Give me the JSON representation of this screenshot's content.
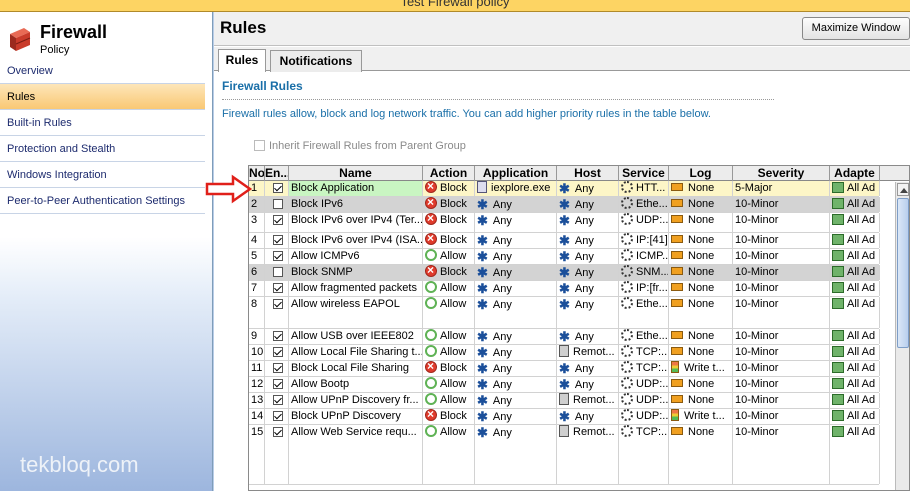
{
  "window": {
    "title": "Test Firewall policy"
  },
  "sidebar": {
    "brand_title": "Firewall",
    "brand_subtitle": "Policy",
    "items": [
      {
        "label": "Overview"
      },
      {
        "label": "Rules"
      },
      {
        "label": "Built-in Rules"
      },
      {
        "label": "Protection and Stealth"
      },
      {
        "label": "Windows Integration"
      },
      {
        "label": "Peer-to-Peer Authentication Settings"
      }
    ],
    "active_index": 1
  },
  "watermark": "tekbloq.com",
  "main": {
    "title": "Rules",
    "maximize_label": "Maximize Window",
    "tabs": [
      {
        "label": "Rules"
      },
      {
        "label": "Notifications"
      }
    ],
    "section_title": "Firewall Rules",
    "description": "Firewall rules allow, block and log network traffic. You can add higher priority rules in the table below.",
    "inherit_label": "Inherit Firewall Rules from Parent Group"
  },
  "table": {
    "columns": [
      "No",
      "En...",
      "Name",
      "Action",
      "Application",
      "Host",
      "Service",
      "Log",
      "Severity",
      "Adapte"
    ],
    "rows": [
      {
        "no": "1",
        "enabled": true,
        "name": "Block Application",
        "action": "Block",
        "app": "iexplore.exe",
        "host": "Any",
        "service": "HTT...",
        "log": "None",
        "severity": "5-Major",
        "adapter": "All Ad"
      },
      {
        "no": "2",
        "enabled": false,
        "name": "Block IPv6",
        "action": "Block",
        "app": "Any",
        "host": "Any",
        "service": "Ethe...",
        "log": "None",
        "severity": "10-Minor",
        "adapter": "All Ad"
      },
      {
        "no": "3",
        "enabled": true,
        "name": "Block IPv6 over IPv4 (Ter...",
        "action": "Block",
        "app": "Any",
        "host": "Any",
        "service": "UDP:...",
        "log": "None",
        "severity": "10-Minor",
        "adapter": "All Ad"
      },
      {
        "no": "4",
        "enabled": true,
        "name": "Block IPv6 over IPv4 (ISA...",
        "action": "Block",
        "app": "Any",
        "host": "Any",
        "service": "IP:[41]",
        "log": "None",
        "severity": "10-Minor",
        "adapter": "All Ad"
      },
      {
        "no": "5",
        "enabled": true,
        "name": "Allow ICMPv6",
        "action": "Allow",
        "app": "Any",
        "host": "Any",
        "service": "ICMP...",
        "log": "None",
        "severity": "10-Minor",
        "adapter": "All Ad"
      },
      {
        "no": "6",
        "enabled": false,
        "name": "Block SNMP",
        "action": "Block",
        "app": "Any",
        "host": "Any",
        "service": "SNM...",
        "log": "None",
        "severity": "10-Minor",
        "adapter": "All Ad"
      },
      {
        "no": "7",
        "enabled": true,
        "name": "Allow fragmented packets",
        "action": "Allow",
        "app": "Any",
        "host": "Any",
        "service": "IP:[fr...",
        "log": "None",
        "severity": "10-Minor",
        "adapter": "All Ad"
      },
      {
        "no": "8",
        "enabled": true,
        "name": "Allow wireless EAPOL",
        "action": "Allow",
        "app": "Any",
        "host": "Any",
        "service": "Ethe...",
        "log": "None",
        "severity": "10-Minor",
        "adapter": "All Ad"
      },
      {
        "no": "9",
        "enabled": true,
        "name": "Allow USB over IEEE802",
        "action": "Allow",
        "app": "Any",
        "host": "Any",
        "service": "Ethe...",
        "log": "None",
        "severity": "10-Minor",
        "adapter": "All Ad"
      },
      {
        "no": "10",
        "enabled": true,
        "name": "Allow Local File Sharing t...",
        "action": "Allow",
        "app": "Any",
        "host": "Remot...",
        "service": "TCP:...",
        "log": "None",
        "severity": "10-Minor",
        "adapter": "All Ad"
      },
      {
        "no": "11",
        "enabled": true,
        "name": "Block Local File Sharing",
        "action": "Block",
        "app": "Any",
        "host": "Any",
        "service": "TCP:...",
        "log": "Write t...",
        "severity": "10-Minor",
        "adapter": "All Ad"
      },
      {
        "no": "12",
        "enabled": true,
        "name": "Allow Bootp",
        "action": "Allow",
        "app": "Any",
        "host": "Any",
        "service": "UDP:...",
        "log": "None",
        "severity": "10-Minor",
        "adapter": "All Ad"
      },
      {
        "no": "13",
        "enabled": true,
        "name": "Allow UPnP Discovery fr...",
        "action": "Allow",
        "app": "Any",
        "host": "Remot...",
        "service": "UDP:...",
        "log": "None",
        "severity": "10-Minor",
        "adapter": "All Ad"
      },
      {
        "no": "14",
        "enabled": true,
        "name": "Block UPnP Discovery",
        "action": "Block",
        "app": "Any",
        "host": "Any",
        "service": "UDP:...",
        "log": "Write t...",
        "severity": "10-Minor",
        "adapter": "All Ad"
      },
      {
        "no": "15",
        "enabled": true,
        "name": "Allow Web Service requ...",
        "action": "Allow",
        "app": "Any",
        "host": "Remot...",
        "service": "TCP:...",
        "log": "None",
        "severity": "10-Minor",
        "adapter": "All Ad"
      }
    ]
  }
}
